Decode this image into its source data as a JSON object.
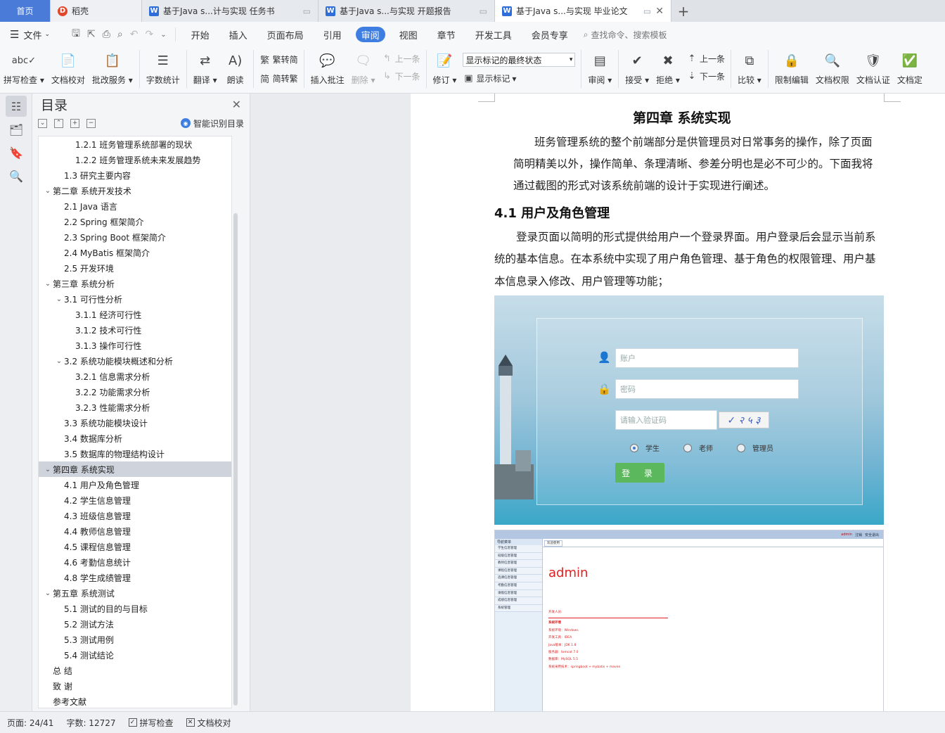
{
  "tabs": [
    {
      "label": "首页",
      "kind": "home"
    },
    {
      "label": "稻壳",
      "kind": "daoke"
    },
    {
      "label": "基于Java s...计与实现 任务书",
      "kind": "doc"
    },
    {
      "label": "基于Java s...与实现 开题报告",
      "kind": "doc"
    },
    {
      "label": "基于Java s...与实现 毕业论文",
      "kind": "doc",
      "active": true
    }
  ],
  "menu": {
    "file": "文件",
    "items": [
      "开始",
      "插入",
      "页面布局",
      "引用",
      "审阅",
      "视图",
      "章节",
      "开发工具",
      "会员专享"
    ],
    "active": "审阅",
    "search": "查找命令、搜索模板"
  },
  "ribbon": {
    "spell_check": "拼写检查",
    "doc_proof": "文档校对",
    "batch_service": "批改服务",
    "word_count": "字数统计",
    "translate": "翻译",
    "read_aloud": "朗读",
    "trad_to_simp": "繁转简",
    "simp_to_trad": "简转繁",
    "insert_comment": "插入批注",
    "delete": "删除",
    "prev_comment": "上一条",
    "next_comment": "下一条",
    "track_changes": "修订",
    "display_state": "显示标记的最终状态",
    "show_markup": "显示标记",
    "review": "审阅",
    "accept": "接受",
    "reject": "拒绝",
    "prev_change": "上一条",
    "next_change": "下一条",
    "compare": "比较",
    "restrict_edit": "限制编辑",
    "doc_permission": "文档权限",
    "doc_cert": "文档认证",
    "doc_final": "文档定"
  },
  "toc": {
    "title": "目录",
    "smart_label": "智能识别目录",
    "items": [
      {
        "text": "1.2.1  班务管理系统部署的现状",
        "level": 3
      },
      {
        "text": "1.2.2  班务管理系统未来发展趋势",
        "level": 3
      },
      {
        "text": "1.3  研究主要内容",
        "level": 2
      },
      {
        "text": "第二章  系统开发技术",
        "level": 1,
        "arrow": true
      },
      {
        "text": "2.1 Java 语言",
        "level": 2
      },
      {
        "text": "2.2 Spring 框架简介",
        "level": 2
      },
      {
        "text": "2.3 Spring Boot 框架简介",
        "level": 2
      },
      {
        "text": "2.4 MyBatis  框架简介",
        "level": 2
      },
      {
        "text": "2.5  开发环境",
        "level": 2
      },
      {
        "text": "第三章  系统分析",
        "level": 1,
        "arrow": true
      },
      {
        "text": "3.1  可行性分析",
        "level": 2,
        "arrow": true
      },
      {
        "text": "3.1.1  经济可行性",
        "level": 3
      },
      {
        "text": "3.1.2  技术可行性",
        "level": 3
      },
      {
        "text": "3.1.3  操作可行性",
        "level": 3
      },
      {
        "text": "3.2  系统功能模块概述和分析",
        "level": 2,
        "arrow": true
      },
      {
        "text": "3.2.1  信息需求分析",
        "level": 3
      },
      {
        "text": "3.2.2  功能需求分析",
        "level": 3
      },
      {
        "text": "3.2.3  性能需求分析",
        "level": 3
      },
      {
        "text": "3.3  系统功能模块设计",
        "level": 2
      },
      {
        "text": "3.4  数据库分析",
        "level": 2
      },
      {
        "text": "3.5  数据库的物理结构设计",
        "level": 2
      },
      {
        "text": "第四章  系统实现",
        "level": 1,
        "arrow": true,
        "active": true
      },
      {
        "text": "4.1  用户及角色管理",
        "level": 2
      },
      {
        "text": "4.2  学生信息管理",
        "level": 2
      },
      {
        "text": "4.3  班级信息管理",
        "level": 2
      },
      {
        "text": "4.4  教师信息管理",
        "level": 2
      },
      {
        "text": "4.5  课程信息管理",
        "level": 2
      },
      {
        "text": "4.6  考勤信息统计",
        "level": 2
      },
      {
        "text": "4.8  学生成绩管理",
        "level": 2
      },
      {
        "text": "第五章  系统测试",
        "level": 1,
        "arrow": true
      },
      {
        "text": "5.1  测试的目的与目标",
        "level": 2
      },
      {
        "text": "5.2  测试方法",
        "level": 2
      },
      {
        "text": "5.3  测试用例",
        "level": 2
      },
      {
        "text": "5.4  测试结论",
        "level": 2
      },
      {
        "text": "总      结",
        "level": 0
      },
      {
        "text": "致      谢",
        "level": 0
      },
      {
        "text": "参考文献",
        "level": 0
      }
    ]
  },
  "doc": {
    "chapter_title": "第四章  系统实现",
    "intro_lines": [
      "班务管理系统的整个前端部分是供管理员对日常事务的操作，除了页面",
      "简明精美以外，操作简单、条理清晰、参差分明也是必不可少的。下面我将",
      "通过截图的形式对该系统前端的设计于实现进行阐述。"
    ],
    "section_title": "4.1  用户及角色管理",
    "section_lines": [
      "登录页面以简明的形式提供给用户一个登录界面。用户登录后会显示当前系",
      "统的基本信息。在本系统中实现了用户角色管理、基于角色的权限管理、用户基",
      "本信息录入修改、用户管理等功能；"
    ]
  },
  "login_figure": {
    "account_placeholder": "账户",
    "password_placeholder": "密码",
    "captcha_placeholder": "请输入验证码",
    "roles": [
      "学生",
      "老师",
      "管理员"
    ],
    "selected_role": "学生",
    "login_button": "登  录"
  },
  "admin_figure": {
    "topbar": [
      "admin",
      "注销",
      "安全退出"
    ],
    "sidebar_header": "导航菜单",
    "sidebar_items": [
      "学生信息管理",
      "班级信息管理",
      "教师信息管理",
      "课程信息管理",
      "选课信息管理",
      "考勤信息管理",
      "请假信息管理",
      "成绩信息管理",
      "系统管理"
    ],
    "tab": "欢迎使用",
    "welcome": "admin",
    "info_lines": [
      "开发人员:",
      "系统环境",
      "系统环境：Windows",
      "开发工具：IDEA",
      "Java版本：JDK 1.8",
      "服务器：tomcat 7.0",
      "数据库：MySQL 5.5",
      "系统采用技术：springboot + mybatis + maven"
    ]
  },
  "status": {
    "page": "页面: 24/41",
    "words": "字数: 12727",
    "spell": "拼写检查",
    "proof": "文档校对"
  },
  "colors": {
    "accent": "#3d7ee0",
    "home_tab": "#4a7bd8",
    "admin_red": "#e02020",
    "login_green": "#5bb85d"
  }
}
